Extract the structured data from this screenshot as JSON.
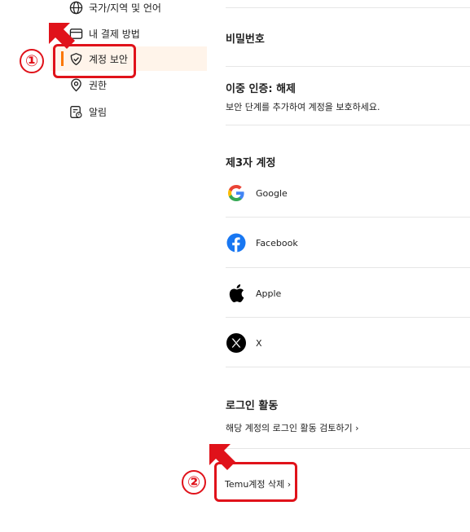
{
  "sidebar": {
    "items": [
      {
        "label": "국가/지역 및 언어",
        "icon": "globe-icon"
      },
      {
        "label": "내 결제 방법",
        "icon": "card-icon"
      },
      {
        "label": "계정 보안",
        "icon": "shield-check-icon",
        "active": true
      },
      {
        "label": "권한",
        "icon": "location-pin-icon"
      },
      {
        "label": "알림",
        "icon": "bell-document-icon"
      }
    ]
  },
  "main": {
    "password_title": "비밀번호",
    "two_factor": {
      "title": "이중 인증: 해제",
      "description": "보안 단계를 추가하여 계정을 보호하세요."
    },
    "third_party": {
      "title": "제3자 계정",
      "accounts": [
        {
          "name": "Google",
          "icon": "google-icon"
        },
        {
          "name": "Facebook",
          "icon": "facebook-icon"
        },
        {
          "name": "Apple",
          "icon": "apple-icon"
        },
        {
          "name": "X",
          "icon": "x-icon"
        }
      ]
    },
    "login_activity": {
      "title": "로그인 활동",
      "link": "해당 계정의 로그인 활동 검토하기"
    },
    "delete_account": {
      "link": "Temu계정 삭제"
    }
  },
  "annotations": {
    "step1": "①",
    "step2": "②",
    "color": "#e0121a"
  },
  "colors": {
    "accent": "#fb7701",
    "active_bg": "#fff4ea",
    "divider": "#e6e6e6"
  }
}
